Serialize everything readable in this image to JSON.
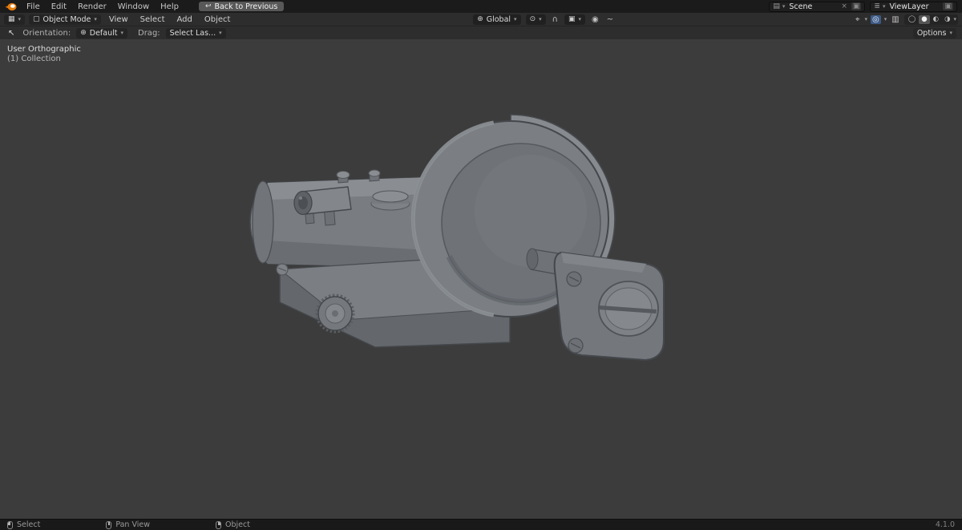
{
  "colors": {
    "topbar-bg": "#1b1b1b",
    "header-bg": "#2d2d2d",
    "viewport-bg": "#3c3c3c",
    "statusbar-bg": "#191919",
    "accent-blue": "#4772b3",
    "model-gray": "#7b7f84",
    "back-button-bg": "#585858"
  },
  "topbar": {
    "menus": [
      "File",
      "Edit",
      "Render",
      "Window",
      "Help"
    ],
    "back_button": "Back to Previous",
    "scene": {
      "label": "Scene"
    },
    "viewlayer": {
      "label": "ViewLayer"
    }
  },
  "viewport_header": {
    "editor_mode": "Object Mode",
    "menus": [
      "View",
      "Select",
      "Add",
      "Object"
    ],
    "orientation": "Global"
  },
  "tool_settings": {
    "orientation_label": "Orientation:",
    "orientation_value": "Default",
    "drag_label": "Drag:",
    "drag_value": "Select Las...",
    "options": "Options"
  },
  "viewport": {
    "view_label": "User Orthographic",
    "collection_label": "(1) Collection"
  },
  "statusbar": {
    "items": [
      {
        "label": "Select"
      },
      {
        "label": "Pan View"
      },
      {
        "label": "Object"
      }
    ],
    "version": "4.1.0"
  },
  "icons": {
    "back_arrow": "↩",
    "chevron": "▾",
    "editor_type": "▦",
    "object_mode": "▢",
    "orientation": "⊕",
    "pivot": "⊙",
    "magnet": "∩",
    "snap": "▣",
    "prop_edit": "◉",
    "falloff": "~",
    "gizmo": "⌖",
    "overlays": "◎",
    "xray": "▥",
    "shading_wireframe": "◯",
    "shading_solid": "●",
    "shading_material": "◐",
    "shading_rendered": "◑",
    "scene": "▤",
    "viewlayer": "≣",
    "unlink": "×",
    "duplicate": "▣",
    "tool_tweak": "↖"
  }
}
